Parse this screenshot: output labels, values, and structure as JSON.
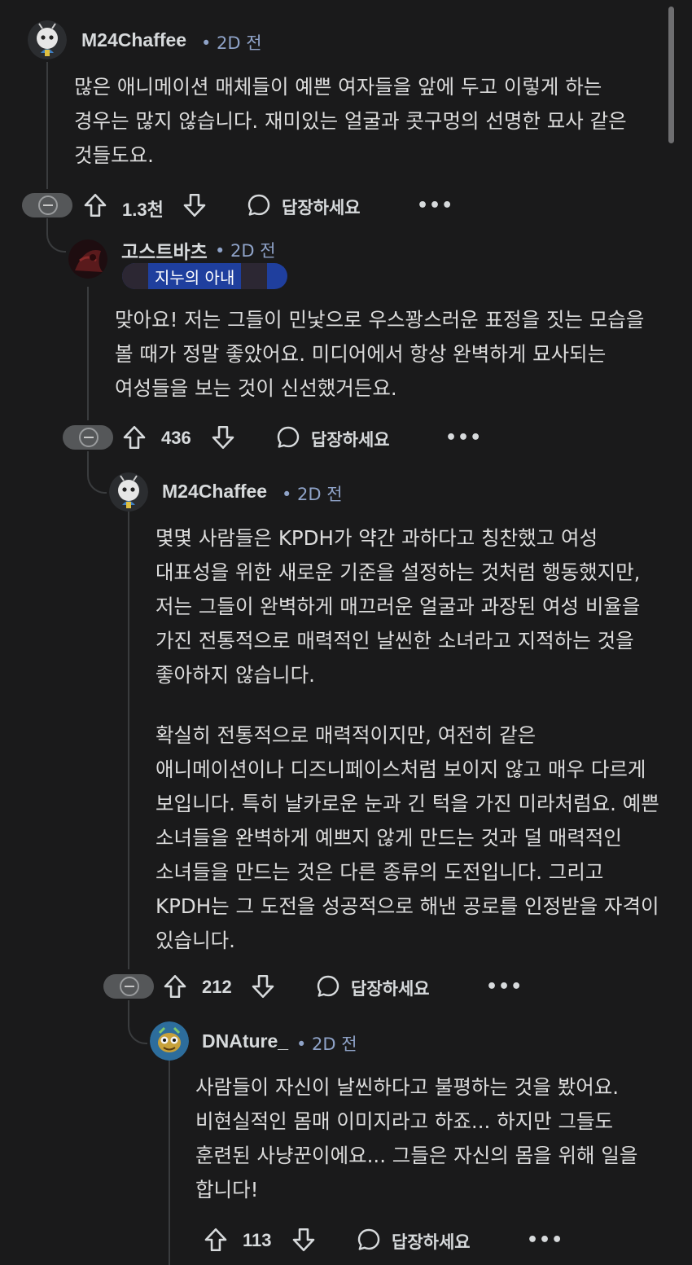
{
  "comments": [
    {
      "author": "M24Chaffee",
      "time": "• 2D 전",
      "paragraphs": [
        "많은 애니메이션 매체들이 예쁜 여자들을 앞에 두고 이렇게 하는 경우는 많지 않습니다. 재미있는 얼굴과 콧구멍의 선명한 묘사 같은 것들도요."
      ],
      "votes": "1.3천",
      "reply_label": "답장하세요",
      "more": "•••"
    },
    {
      "author": "고스트바츠",
      "time": "• 2D 전",
      "flair": "지누의 아내",
      "paragraphs": [
        "맞아요! 저는 그들이 민낯으로 우스꽝스러운 표정을 짓는 모습을 볼 때가 정말 좋았어요. 미디어에서 항상 완벽하게 묘사되는 여성들을 보는 것이 신선했거든요."
      ],
      "votes": "436",
      "reply_label": "답장하세요",
      "more": "•••"
    },
    {
      "author": "M24Chaffee",
      "time": "• 2D 전",
      "paragraphs": [
        "몇몇 사람들은 KPDH가 약간 과하다고 칭찬했고 여성 대표성을 위한 새로운 기준을 설정하는 것처럼 행동했지만, 저는 그들이 완벽하게 매끄러운 얼굴과 과장된 여성 비율을 가진 전통적으로 매력적인 날씬한 소녀라고 지적하는 것을 좋아하지 않습니다.",
        "확실히 전통적으로 매력적이지만, 여전히 같은 애니메이션이나 디즈니페이스처럼 보이지 않고 매우 다르게 보입니다. 특히 날카로운 눈과 긴 턱을 가진 미라처럼요. 예쁜 소녀들을 완벽하게 예쁘지 않게 만드는 것과 덜 매력적인 소녀들을 만드는 것은 다른 종류의 도전입니다. 그리고 KPDH는 그 도전을 성공적으로 해낸 공로를 인정받을 자격이 있습니다."
      ],
      "votes": "212",
      "reply_label": "답장하세요",
      "more": "•••"
    },
    {
      "author": "DNAture_",
      "time": "• 2D 전",
      "paragraphs": [
        "사람들이 자신이 날씬하다고 불평하는 것을 봤어요. 비현실적인 몸매 이미지라고 하죠... 하지만 그들도 훈련된 사냥꾼이에요... 그들은 자신의 몸을 위해 일을 합니다!"
      ],
      "votes": "113",
      "reply_label": "답장하세요",
      "more": "•••"
    }
  ],
  "colors": {
    "background": "#1a1a1b",
    "text": "#d7dadc",
    "meta": "#8fa3c8",
    "flair_bg": "#1f3f9e",
    "thread_line": "#3a3c3e"
  }
}
